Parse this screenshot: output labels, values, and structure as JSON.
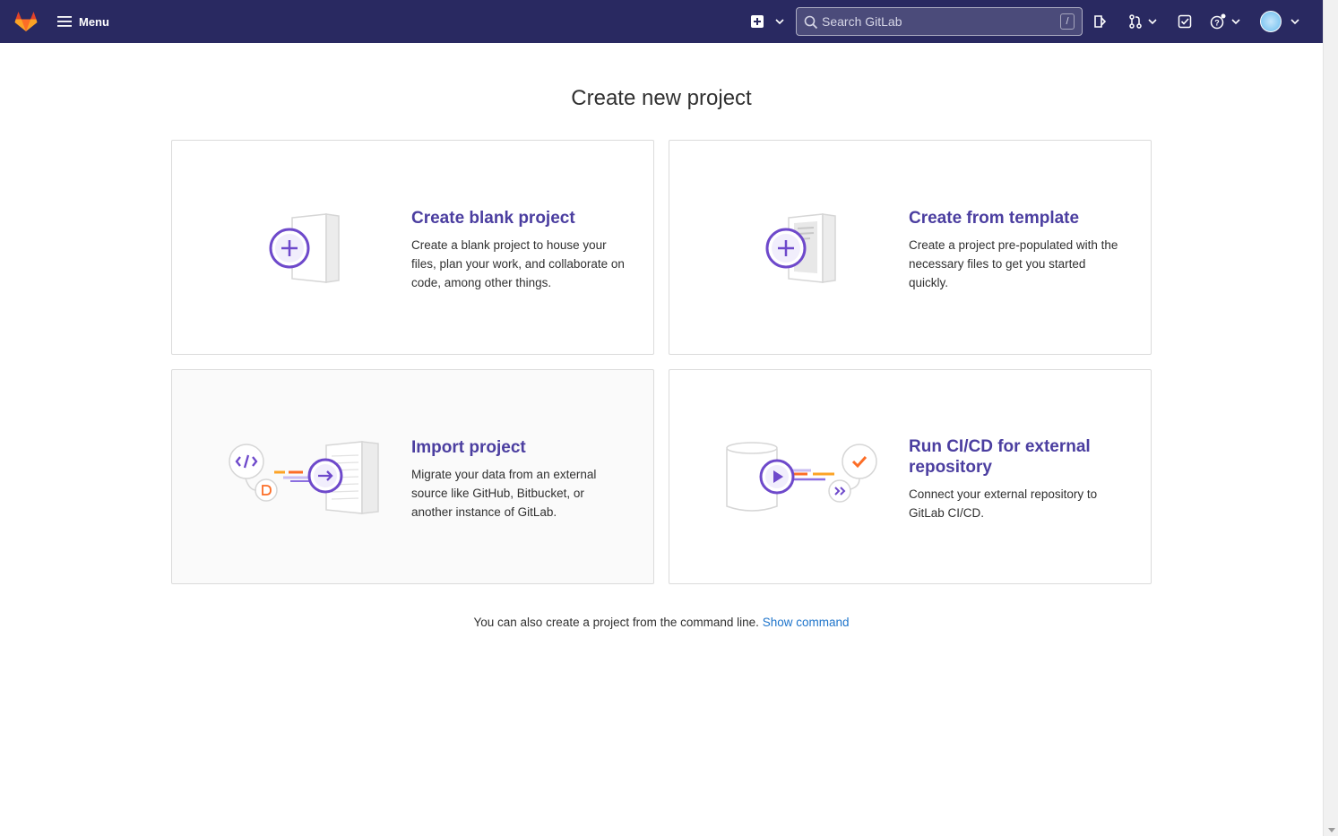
{
  "navbar": {
    "menu_label": "Menu",
    "search_placeholder": "Search GitLab",
    "search_shortcut": "/"
  },
  "page": {
    "title": "Create new project"
  },
  "panels": [
    {
      "title": "Create blank project",
      "description": "Create a blank project to house your files, plan your work, and collaborate on code, among other things."
    },
    {
      "title": "Create from template",
      "description": "Create a project pre-populated with the necessary files to get you started quickly."
    },
    {
      "title": "Import project",
      "description": "Migrate your data from an external source like GitHub, Bitbucket, or another instance of GitLab."
    },
    {
      "title": "Run CI/CD for external repository",
      "description": "Connect your external repository to GitLab CI/CD."
    }
  ],
  "footer": {
    "text": "You can also create a project from the command line.",
    "link_label": "Show command"
  },
  "colors": {
    "navbar_bg": "#292961",
    "accent_purple": "#6e49cb",
    "title_purple": "#4b3ea0",
    "link_blue": "#1f75cb",
    "orange": "#fc6d26"
  }
}
